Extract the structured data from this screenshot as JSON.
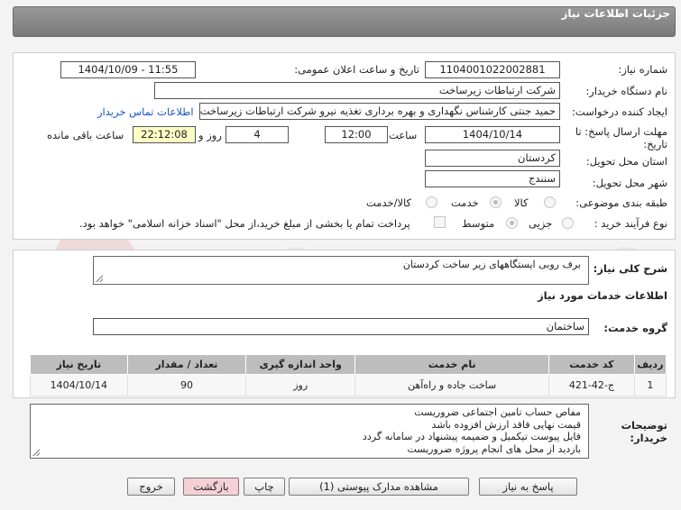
{
  "header": {
    "title": "جزئیات اطلاعات نیاز"
  },
  "form": {
    "need_number_label": "شماره نیاز:",
    "need_number": "1104001022002881",
    "announce_label": "تاریخ و ساعت اعلان عمومی:",
    "announce_value": "1404/10/09 - 11:55",
    "buyer_org_label": "نام دستگاه خریدار:",
    "buyer_org": "شرکت ارتباطات زیرساخت",
    "creator_label": "ایجاد کننده درخواست:",
    "creator": "حمید جنتی کارشناس نگهداری و بهره برداری تغذیه نیرو شرکت ارتباطات زیرساخت",
    "contact_link": "اطلاعات تماس خریدار",
    "deadline_label_1": "مهلت ارسال پاسخ: تا",
    "deadline_label_2": "تاریخ:",
    "deadline_date": "1404/10/14",
    "time_label": "ساعت",
    "deadline_time": "12:00",
    "days_value": "4",
    "days_label": "روز و",
    "remaining_time": "22:12:08",
    "remaining_label": "ساعت باقی مانده",
    "province_label": "استان محل تحویل:",
    "province": "کردستان",
    "city_label": "شهر محل تحویل:",
    "city": "سنندج",
    "category_label": "طبقه بندی موضوعی:",
    "category_options": [
      "کالا",
      "خدمت",
      "کالا/خدمت"
    ],
    "category_selected": "خدمت",
    "process_label": "نوع فرآیند خرید :",
    "process_options": [
      "جزیی",
      "متوسط"
    ],
    "process_selected": "متوسط",
    "treasury_note": "پرداخت تمام یا بخشی از مبلغ خرید،از محل \"اسناد خزانه اسلامی\" خواهد بود."
  },
  "description": {
    "label": "شرح کلی نیاز:",
    "value": "برف روبی ایستگاههای زیر ساخت کردستان"
  },
  "services": {
    "section_title": "اطلاعات خدمات مورد نیاز",
    "group_label": "گروه خدمت:",
    "group_value": "ساختمان",
    "columns": [
      "ردیف",
      "کد خدمت",
      "نام خدمت",
      "واحد اندازه گیری",
      "تعداد / مقدار",
      "تاریخ نیاز"
    ],
    "rows": [
      [
        "1",
        "ج-42-421",
        "ساخت جاده و راه‌آهن",
        "روز",
        "90",
        "1404/10/14"
      ]
    ]
  },
  "buyer_notes": {
    "label_1": "توضیحات",
    "label_2": "خریدار:",
    "lines": [
      "مفاص حساب تامین اجتماعی ضروریست",
      "قیمت نهایی فاقد ارزش افزوده باشد",
      "فایل پیوست تیکمیل و  ضمیمه پیشنهاد در سامانه گردد",
      "بازدید از محل های انجام پروژه ضروریست"
    ]
  },
  "buttons": {
    "reply": "پاسخ به نیاز",
    "view_docs": "مشاهده مدارک پیوستی (1)",
    "print": "چاپ",
    "back": "بازگشت",
    "exit": "خروج"
  },
  "colors": {
    "header_bg": "#8a8a8a",
    "link": "#1a55c4",
    "remaining_bg": "#ffffc6",
    "table_header_bg": "#bdbdbd",
    "back_button_bg": "#f6d0d6"
  }
}
